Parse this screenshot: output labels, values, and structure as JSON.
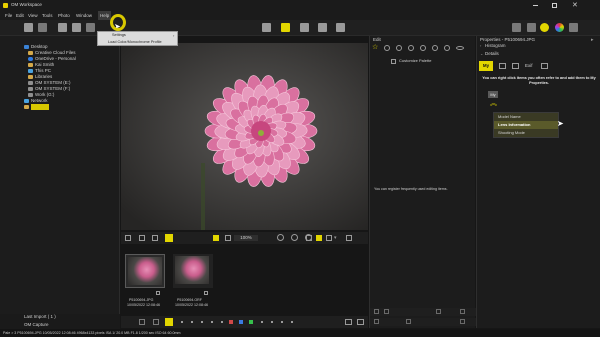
{
  "app": {
    "title": "OM Workspace",
    "window_controls": [
      "minimize-icon",
      "maximize-icon",
      "close-icon"
    ]
  },
  "menu": [
    "File",
    "Edit",
    "View",
    "Tools",
    "Photo",
    "Window",
    "Help"
  ],
  "help_popup": {
    "items": [
      "Settings",
      "Load Color/Monochrome Profile"
    ]
  },
  "folders": {
    "items": [
      {
        "label": "Desktop",
        "icon": "folder-blue-icon"
      },
      {
        "label": "Creative Cloud Files",
        "icon": "folder-icon"
      },
      {
        "label": "OneDrive - Personal",
        "icon": "cloud-icon"
      },
      {
        "label": "Kai Smith",
        "icon": "user-folder-icon"
      },
      {
        "label": "This PC",
        "icon": "pc-icon"
      },
      {
        "label": "Libraries",
        "icon": "folder-icon"
      },
      {
        "label": "OM SYSTEM (E:)",
        "icon": "drive-icon"
      },
      {
        "label": "OM SYSTEM (F:)",
        "icon": "drive-icon"
      },
      {
        "label": "Work (G:)",
        "icon": "drive-icon"
      },
      {
        "label": "Network",
        "icon": "network-icon"
      },
      {
        "label": "",
        "icon": "folder-yellow-icon"
      }
    ],
    "last_import": "Last Import ( 1 )",
    "om_capture": "OM Capture"
  },
  "viewer": {
    "zoom": "100%"
  },
  "thumbnails": [
    {
      "name": "P5100694.JPG",
      "date": "10/05/2022 12:08:46"
    },
    {
      "name": "P5100694.ORF",
      "date": "10/05/2022 12:08:46"
    }
  ],
  "edit_panel": {
    "title": "Edit",
    "palette_label": "Customize Palette",
    "empty_message": "You can register frequently used editing items."
  },
  "properties": {
    "title": "Properties - P5100694.JPG",
    "histogram": "Histogram",
    "details": "Details",
    "tabs": [
      "My",
      "",
      "",
      "Exif",
      ""
    ],
    "hint": "You can right click items you often refer to and add them to My Properties.",
    "my_badge": "My",
    "list": [
      "Model Name",
      "Lens Information",
      "Shooting Mode"
    ]
  },
  "status_bar": "Pale > 3 P5100694.JPG 10/05/2022 12:08:46 4968x4133 pixels ISA 1/ 20.0 MB F1.8 1/200 sec ISO 64 60.0mm",
  "colors": {
    "accent": "#d8c800",
    "highlight": "#3a3a24",
    "selected_item": "#5a5a2a"
  }
}
